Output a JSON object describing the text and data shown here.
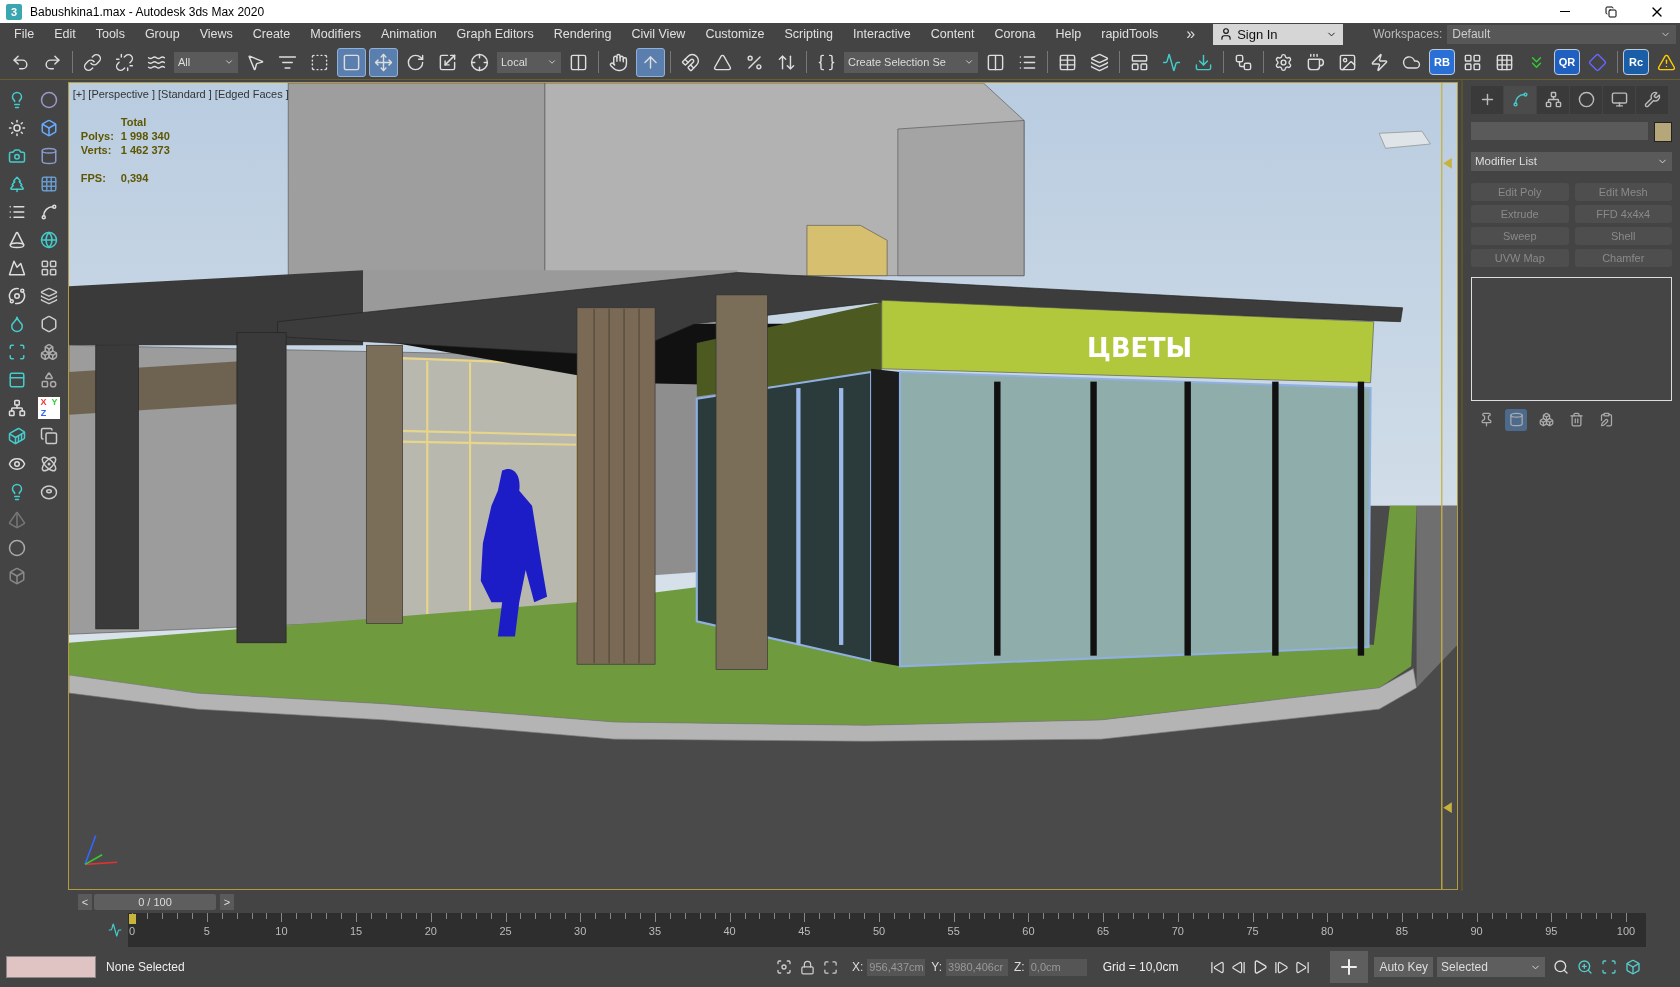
{
  "window": {
    "app_icon": "3",
    "title": "Babushkina1.max - Autodesk 3ds Max 2020"
  },
  "menu": {
    "items": [
      "File",
      "Edit",
      "Tools",
      "Group",
      "Views",
      "Create",
      "Modifiers",
      "Animation",
      "Graph Editors",
      "Rendering",
      "Civil View",
      "Customize",
      "Scripting",
      "Interactive",
      "Content",
      "Corona",
      "Help",
      "rapidTools"
    ],
    "overflow": "»",
    "sign_in": "Sign In",
    "workspaces_label": "Workspaces:",
    "workspace": "Default"
  },
  "main_toolbar": [
    {
      "kind": "icon",
      "selected": false
    },
    {
      "kind": "icon",
      "selected": false
    },
    {
      "kind": "separator"
    },
    {
      "kind": "icon",
      "selected": false
    },
    {
      "kind": "icon",
      "selected": false
    },
    {
      "kind": "icon",
      "selected": false
    },
    {
      "kind": "dropdown",
      "value": "All"
    },
    {
      "kind": "icon",
      "selected": false
    },
    {
      "kind": "icon",
      "selected": false
    },
    {
      "kind": "icon",
      "selected": false
    },
    {
      "kind": "icon",
      "selected": true
    },
    {
      "kind": "icon",
      "selected": true
    },
    {
      "kind": "icon",
      "selected": false
    },
    {
      "kind": "icon",
      "selected": false
    },
    {
      "kind": "icon",
      "selected": false
    },
    {
      "kind": "dropdown",
      "value": "Local"
    },
    {
      "kind": "icon",
      "selected": false
    },
    {
      "kind": "separator"
    },
    {
      "kind": "icon",
      "selected": false
    },
    {
      "kind": "icon",
      "selected": true
    },
    {
      "kind": "separator"
    },
    {
      "kind": "icon",
      "selected": false
    },
    {
      "kind": "icon",
      "selected": false
    },
    {
      "kind": "icon",
      "selected": false
    },
    {
      "kind": "icon",
      "selected": false
    },
    {
      "kind": "separator"
    },
    {
      "kind": "icon",
      "selected": false
    },
    {
      "kind": "dropdown",
      "value": "Create Selection Se"
    },
    {
      "kind": "icon",
      "selected": false
    },
    {
      "kind": "icon",
      "selected": false
    },
    {
      "kind": "separator"
    },
    {
      "kind": "icon",
      "selected": false
    },
    {
      "kind": "icon",
      "selected": false
    },
    {
      "kind": "separator"
    },
    {
      "kind": "icon",
      "selected": false
    },
    {
      "kind": "icon",
      "selected": false
    },
    {
      "kind": "icon",
      "selected": false
    },
    {
      "kind": "separator"
    },
    {
      "kind": "icon",
      "selected": false
    },
    {
      "kind": "separator"
    },
    {
      "kind": "icon",
      "selected": false
    },
    {
      "kind": "icon",
      "selected": false
    },
    {
      "kind": "icon",
      "selected": false
    },
    {
      "kind": "icon",
      "selected": false
    },
    {
      "kind": "icon",
      "selected": false
    },
    {
      "kind": "badge",
      "label": "RB",
      "color": "#2a6fd6"
    },
    {
      "kind": "icon",
      "selected": false
    },
    {
      "kind": "icon",
      "selected": false
    },
    {
      "kind": "icon",
      "selected": false
    },
    {
      "kind": "badge",
      "label": "QR",
      "color": "#1f5fc0"
    },
    {
      "kind": "icon",
      "selected": false
    },
    {
      "kind": "separator"
    },
    {
      "kind": "badge",
      "label": "Rc",
      "color": "#1b5ea8"
    },
    {
      "kind": "icon",
      "selected": false
    }
  ],
  "left_toolbar": {
    "axis_letters": [
      "X",
      "Y",
      "Z"
    ]
  },
  "viewport": {
    "active": true,
    "labels": [
      "[+]",
      "[Perspective ]",
      "[Standard ]",
      "[Edged Faces ]"
    ],
    "stats": {
      "header": "Total",
      "rows": [
        {
          "label": "Polys:",
          "value": "1 998 340"
        },
        {
          "label": "Verts:",
          "value": "1 462 373"
        }
      ],
      "fps": {
        "label": "FPS:",
        "value": "0,394"
      }
    },
    "sign": "ЦВЕТЫ"
  },
  "command_panel": {
    "tabs": [
      {
        "selected": false
      },
      {
        "selected": true
      },
      {
        "selected": false
      },
      {
        "selected": false
      },
      {
        "selected": false
      },
      {
        "selected": false
      }
    ],
    "modifier_list": "Modifier List",
    "buttons": [
      {
        "label": "Edit Poly",
        "disabled": true
      },
      {
        "label": "Edit Mesh",
        "disabled": true
      },
      {
        "label": "Extrude",
        "disabled": true
      },
      {
        "label": "FFD 4x4x4",
        "disabled": true
      },
      {
        "label": "Sweep",
        "disabled": true
      },
      {
        "label": "Shell",
        "disabled": true
      },
      {
        "label": "UVW Map",
        "disabled": true
      },
      {
        "label": "Chamfer",
        "disabled": true
      }
    ],
    "stack_tools": [
      {
        "selected": false
      },
      {
        "selected": true
      },
      {
        "selected": false
      },
      {
        "selected": false
      },
      {
        "selected": false
      }
    ]
  },
  "timeline": {
    "prev": "<",
    "label": "0 / 100",
    "next": ">",
    "level": 0,
    "labels": [
      "0",
      "5",
      "10",
      "15",
      "20",
      "25",
      "30",
      "35",
      "40",
      "45",
      "50",
      "55",
      "60",
      "65",
      "70",
      "75",
      "80",
      "85",
      "90",
      "95",
      "100"
    ]
  },
  "status": {
    "selection": "None Selected",
    "x_label": "X:",
    "x": "956,437cm",
    "y_label": "Y:",
    "y": "3980,406cr",
    "z_label": "Z:",
    "z": "0,0cm",
    "grid": "Grid = 10,0cm",
    "auto_key": "Auto Key",
    "key_mode": "Selected"
  }
}
